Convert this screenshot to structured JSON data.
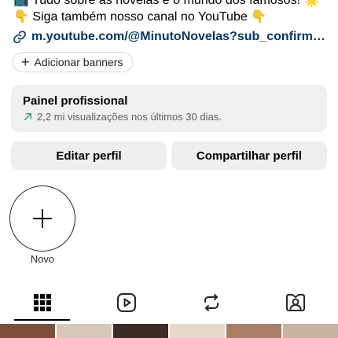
{
  "bio": {
    "line1": "📺 Tudo sobre as novelas e o mundo dos famosos! 🌟",
    "line2": "👇 Siga também nosso canal no YouTube 👇"
  },
  "link": {
    "text": "m.youtube.com/@MinutoNovelas?sub_confirmat..."
  },
  "add_banners_label": "Adicionar banners",
  "professional_panel": {
    "title": "Painel profissional",
    "stats": "2,2 mi visualizações nos últimos 30 dias."
  },
  "buttons": {
    "edit_profile": "Editar perfil",
    "share_profile": "Compartilhar perfil"
  },
  "highlights": {
    "new_label": "Novo"
  },
  "tabs": [
    {
      "icon": "grid-icon",
      "selected": true
    },
    {
      "icon": "reels-icon",
      "selected": false
    },
    {
      "icon": "reposts-icon",
      "selected": false
    },
    {
      "icon": "tagged-icon",
      "selected": false
    }
  ],
  "colors": {
    "link": "#00376b",
    "trend_arrow": "#2e9e5b",
    "panel_bg": "#f0f0f3",
    "button_bg": "#efefef"
  },
  "grid_preview": [
    {
      "color": "#7a4e3a"
    },
    {
      "color": "#d9c7b5"
    },
    {
      "color": "#3b2d26"
    },
    {
      "color": "#e9d8c6"
    },
    {
      "color": "#a87f66"
    },
    {
      "color": "#c9b3a1"
    }
  ]
}
